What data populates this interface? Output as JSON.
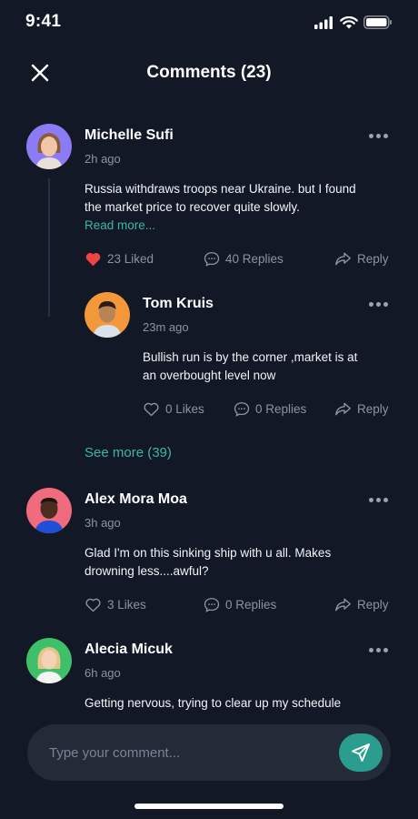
{
  "status_bar": {
    "time": "9:41"
  },
  "header": {
    "title": "Comments (23)"
  },
  "comments": [
    {
      "name": "Michelle Sufi",
      "time": "2h ago",
      "text_line1": "Russia withdraws troops near Ukraine. but I found",
      "text_line2": "the market price to recover quite slowly.",
      "read_more": "Read more...",
      "likes": "23 Liked",
      "replies": "40 Replies",
      "reply": "Reply",
      "avatar_bg": "#8b7cf6",
      "liked_color": "#f04444"
    },
    {
      "name": "Tom Kruis",
      "time": "23m ago",
      "text_line1": "Bullish run is by the corner ,market is at",
      "text_line2": "an overbought level now",
      "likes": "0 Likes",
      "replies": "0 Replies",
      "reply": "Reply",
      "avatar_bg": "#f2973a"
    },
    {
      "name": "Alex Mora Moa",
      "time": "3h ago",
      "text_line1": "Glad I'm on this sinking ship with u all. Makes",
      "text_line2": "drowning less....awful?",
      "likes": "3 Likes",
      "replies": "0 Replies",
      "reply": "Reply",
      "avatar_bg": "#f06b7d"
    },
    {
      "name": "Alecia Micuk",
      "time": "6h ago",
      "text_line1": "Getting nervous, trying to clear up my schedule",
      "avatar_bg": "#3ec06b"
    }
  ],
  "see_more": "See more (39)",
  "composer": {
    "placeholder": "Type your comment..."
  },
  "colors": {
    "background": "#121826",
    "accent": "#2a9d8f",
    "link": "#3db6a3"
  }
}
